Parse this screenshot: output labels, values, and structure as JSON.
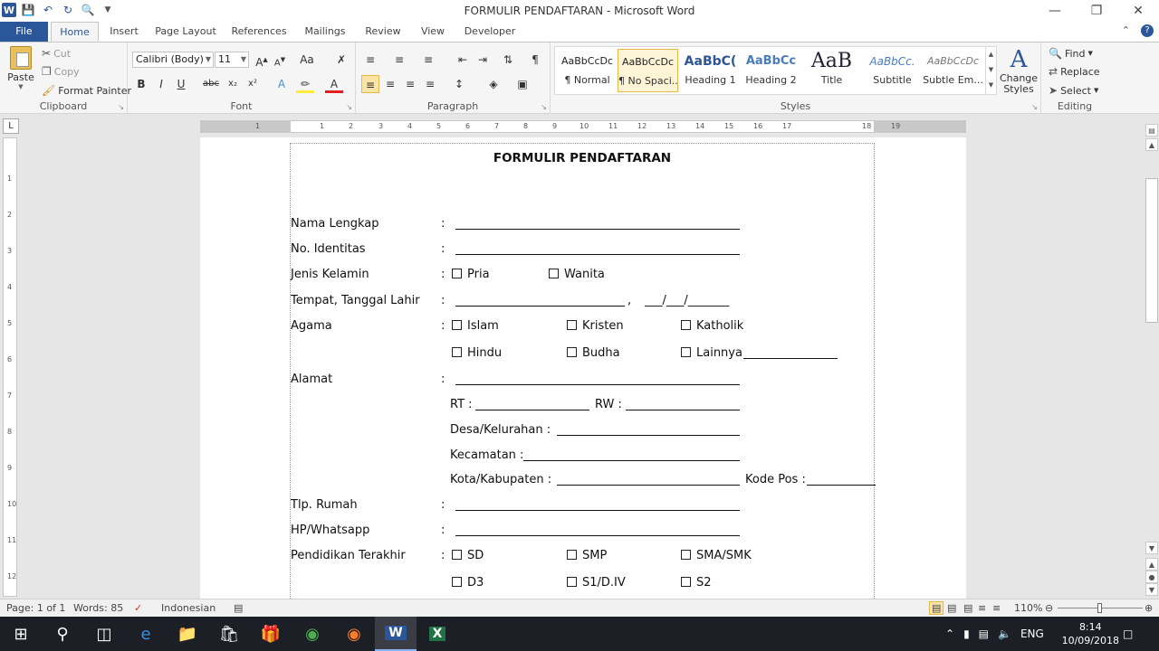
{
  "app": {
    "window_title": "FORMULIR PENDAFTARAN  -  Microsoft Word"
  },
  "tabs": [
    {
      "label": "File"
    },
    {
      "label": "Home"
    },
    {
      "label": "Insert"
    },
    {
      "label": "Page Layout"
    },
    {
      "label": "References"
    },
    {
      "label": "Mailings"
    },
    {
      "label": "Review"
    },
    {
      "label": "View"
    },
    {
      "label": "Developer"
    }
  ],
  "ribbon": {
    "clipboard": {
      "label": "Clipboard",
      "paste": "Paste",
      "cut": "Cut",
      "copy": "Copy",
      "format_painter": "Format Painter"
    },
    "font": {
      "label": "Font",
      "family": "Calibri (Body)",
      "size": "11"
    },
    "paragraph": {
      "label": "Paragraph"
    },
    "styles": {
      "label": "Styles",
      "items": [
        {
          "preview": "AaBbCcDc",
          "name": "¶ Normal"
        },
        {
          "preview": "AaBbCcDc",
          "name": "¶ No Spaci..."
        },
        {
          "preview": "AaBbC(",
          "name": "Heading 1"
        },
        {
          "preview": "AaBbCc",
          "name": "Heading 2"
        },
        {
          "preview": "AaB",
          "name": "Title"
        },
        {
          "preview": "AaBbCc.",
          "name": "Subtitle"
        },
        {
          "preview": "AaBbCcDc",
          "name": "Subtle Em..."
        }
      ],
      "change_styles": "Change Styles"
    },
    "editing": {
      "label": "Editing",
      "find": "Find",
      "replace": "Replace",
      "select": "Select"
    }
  },
  "ruler": {
    "numbers": [
      "1",
      "1",
      "2",
      "3",
      "4",
      "5",
      "6",
      "7",
      "8",
      "9",
      "10",
      "11",
      "12",
      "13",
      "14",
      "15",
      "16",
      "17",
      "18",
      "19"
    ]
  },
  "document": {
    "title": "FORMULIR PENDAFTARAN",
    "fields": {
      "nama": "Nama Lengkap",
      "identitas": "No. Identitas",
      "jenis_kelamin": "Jenis Kelamin",
      "ttl": "Tempat, Tanggal Lahir",
      "agama": "Agama",
      "alamat": "Alamat",
      "tlp": "Tlp. Rumah",
      "hp": "HP/Whatsapp",
      "pendidikan": "Pendidikan Terakhir"
    },
    "colon": ":",
    "options": {
      "pria": "Pria",
      "wanita": "Wanita",
      "islam": "Islam",
      "kristen": "Kristen",
      "katholik": "Katholik",
      "hindu": "Hindu",
      "budha": "Budha",
      "lainnya": "Lainnya",
      "sd": "SD",
      "smp": "SMP",
      "sma": "SMA/SMK",
      "d3": "D3",
      "s1": "S1/D.IV",
      "s2": "S2"
    },
    "ttl_date": "___/___/_______",
    "ttl_comma": ",",
    "address": {
      "rt": "RT :",
      "rw": "RW :",
      "desa": "Desa/Kelurahan :",
      "kecamatan": "Kecamatan :",
      "kota": "Kota/Kabupaten  :",
      "kodepos": "Kode Pos :"
    }
  },
  "status": {
    "page": "Page: 1 of 1",
    "words": "Words: 85",
    "language": "Indonesian",
    "zoom": "110%"
  },
  "taskbar": {
    "language": "ENG",
    "time": "8:14",
    "date": "10/09/2018"
  }
}
